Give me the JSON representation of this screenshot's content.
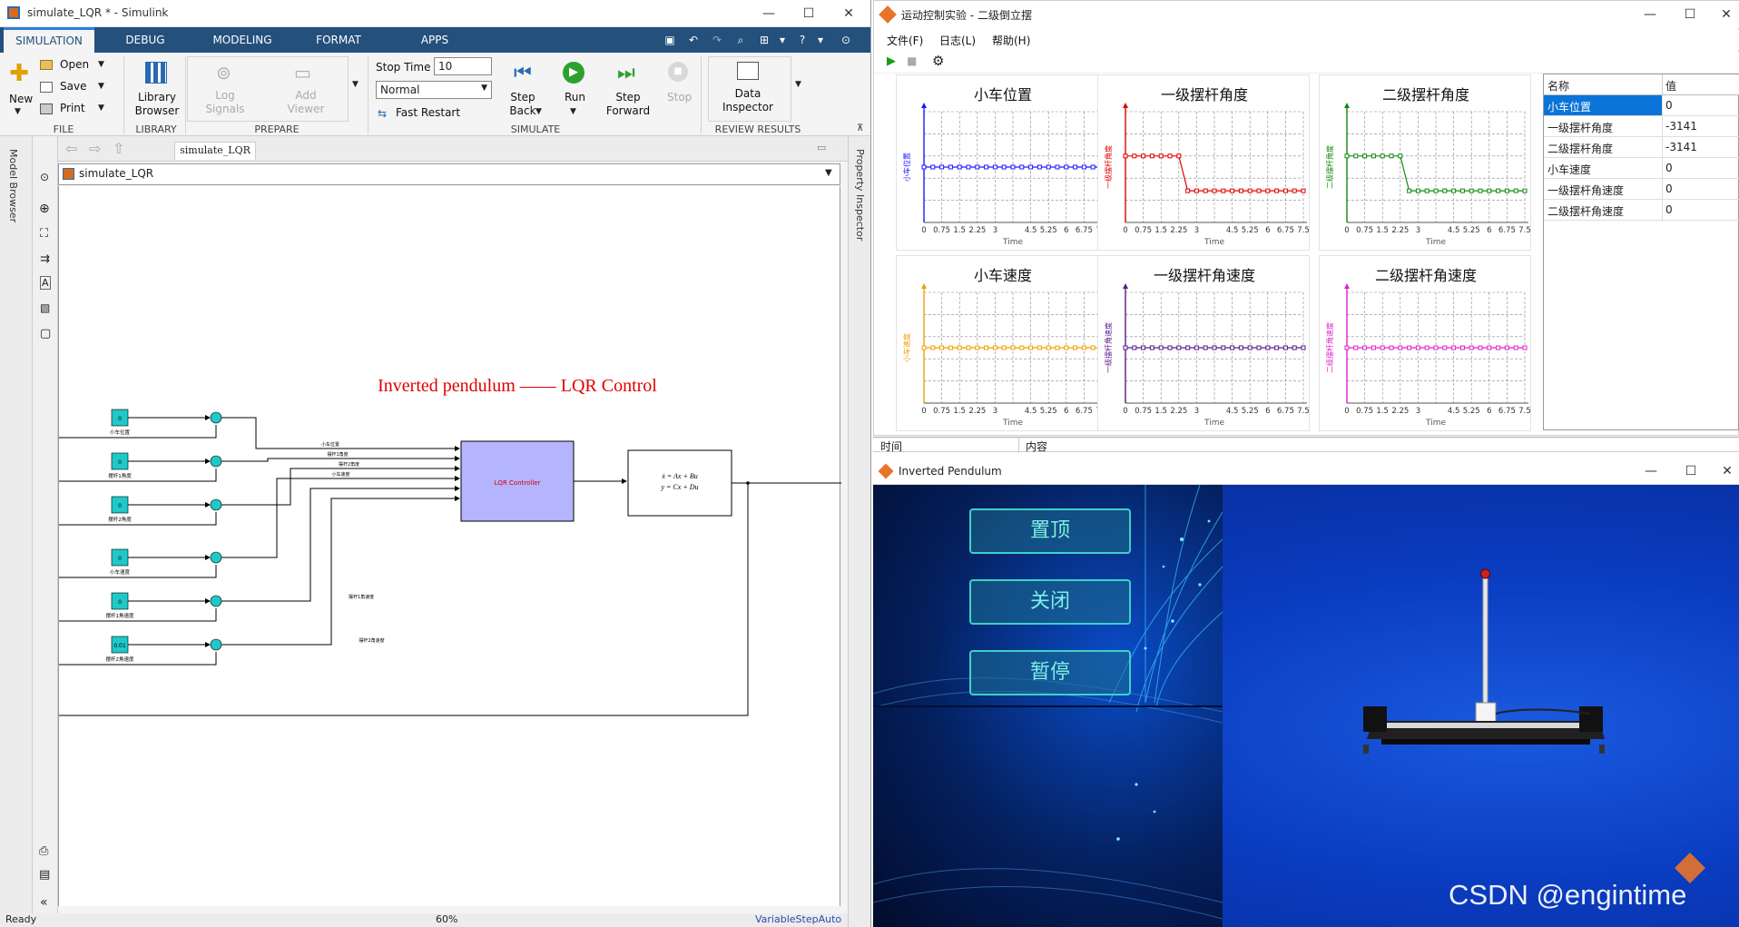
{
  "simulink": {
    "title": "simulate_LQR * - Simulink",
    "tabs": [
      "SIMULATION",
      "DEBUG",
      "MODELING",
      "FORMAT",
      "APPS"
    ],
    "ribbon": {
      "new": "New",
      "open": "Open",
      "save": "Save",
      "print": "Print",
      "library_browser": [
        "Library",
        "Browser"
      ],
      "log_signals": [
        "Log",
        "Signals"
      ],
      "add_viewer": [
        "Add",
        "Viewer"
      ],
      "stop_time_label": "Stop Time",
      "stop_time_value": "10",
      "mode": "Normal",
      "fast_restart": "Fast Restart",
      "step_back": [
        "Step",
        "Back"
      ],
      "run": "Run",
      "step_forward": [
        "Step",
        "Forward"
      ],
      "stop": "Stop",
      "data_inspector": [
        "Data",
        "Inspector"
      ],
      "groups": [
        "FILE",
        "LIBRARY",
        "PREPARE",
        "SIMULATE",
        "REVIEW RESULTS"
      ]
    },
    "breadcrumb_tab": "simulate_LQR",
    "model_path": "simulate_LQR",
    "model_browser": "Model Browser",
    "property_inspector": "Property Inspector",
    "diagram": {
      "title": "Inverted pendulum —— LQR Control",
      "constants": [
        {
          "value": "0",
          "label": "小车位置"
        },
        {
          "value": "0",
          "label": "摆杆1角度"
        },
        {
          "value": "0",
          "label": "摆杆2角度"
        },
        {
          "value": "0",
          "label": "小车速度"
        },
        {
          "value": "0",
          "label": "摆杆1角速度"
        },
        {
          "value": "0.01",
          "label": "摆杆2角速度"
        }
      ],
      "signal_labels": [
        "小车位置",
        "摆杆1角度",
        "摆杆2角度",
        "小车速度",
        "摆杆1角速度",
        "摆杆2角速度"
      ],
      "controller": "LQR Controller",
      "state_space": [
        "ẋ = Ax + Bu",
        "y = Cx + Du"
      ]
    },
    "status": {
      "left": "Ready",
      "zoom": "60%",
      "solver": "VariableStepAuto"
    }
  },
  "control": {
    "title": "运动控制实验 - 二级倒立摆",
    "menu": [
      "文件(F)",
      "日志(L)",
      "帮助(H)"
    ],
    "x_ticks": [
      "0",
      "0.75",
      "1.5",
      "2.25",
      "3",
      "4.5",
      "5.25",
      "6",
      "6.75",
      "7.5"
    ],
    "x_axis_label": "Time",
    "table_header": [
      "名称",
      "值"
    ],
    "table_rows": [
      {
        "name": "小车位置",
        "value": "0",
        "selected": true
      },
      {
        "name": "一级摆杆角度",
        "value": "-3141",
        "selected": false
      },
      {
        "name": "二级摆杆角度",
        "value": "-3141",
        "selected": false
      },
      {
        "name": "小车速度",
        "value": "0",
        "selected": false
      },
      {
        "name": "一级摆杆角速度",
        "value": "0",
        "selected": false
      },
      {
        "name": "二级摆杆角速度",
        "value": "0",
        "selected": false
      }
    ],
    "log_header": [
      "时间",
      "内容"
    ]
  },
  "chart_data": [
    {
      "type": "line",
      "title": "小车位置",
      "color": "#1a1aff",
      "ylabel": "小车位置",
      "xlabel": "Time",
      "x": [
        0,
        0.375,
        0.75,
        1.125,
        1.5,
        1.875,
        2.25,
        2.625,
        3,
        3.375,
        3.75,
        4.125,
        4.5,
        4.875,
        5.25,
        5.625,
        6,
        6.375,
        6.75,
        7.125,
        7.5
      ],
      "values": [
        0,
        0,
        0,
        0,
        0,
        0,
        0,
        0,
        0,
        0,
        0,
        0,
        0,
        0,
        0,
        0,
        0,
        0,
        0,
        0,
        0
      ],
      "ylim": [
        -2,
        2
      ],
      "grid": true
    },
    {
      "type": "line",
      "title": "一级摆杆角度",
      "color": "#e00000",
      "ylabel": "一级摆杆角度",
      "xlabel": "Time",
      "x": [
        0,
        0.375,
        0.75,
        1.125,
        1.5,
        1.875,
        2.25,
        2.625,
        3,
        3.375,
        3.75,
        4.125,
        4.5,
        4.875,
        5.25,
        5.625,
        6,
        6.375,
        6.75,
        7.125,
        7.5
      ],
      "values": [
        0,
        0,
        0,
        0,
        0,
        0,
        0,
        -3141,
        -3141,
        -3141,
        -3141,
        -3141,
        -3141,
        -3141,
        -3141,
        -3141,
        -3141,
        -3141,
        -3141,
        -3141,
        -3141
      ],
      "ylim": [
        -6000,
        4000
      ],
      "grid": true
    },
    {
      "type": "line",
      "title": "二级摆杆角度",
      "color": "#118811",
      "ylabel": "二级摆杆角度",
      "xlabel": "Time",
      "x": [
        0,
        0.375,
        0.75,
        1.125,
        1.5,
        1.875,
        2.25,
        2.625,
        3,
        3.375,
        3.75,
        4.125,
        4.5,
        4.875,
        5.25,
        5.625,
        6,
        6.375,
        6.75,
        7.125,
        7.5
      ],
      "values": [
        0,
        0,
        0,
        0,
        0,
        0,
        0,
        -3141,
        -3141,
        -3141,
        -3141,
        -3141,
        -3141,
        -3141,
        -3141,
        -3141,
        -3141,
        -3141,
        -3141,
        -3141,
        -3141
      ],
      "ylim": [
        -6000,
        4000
      ],
      "grid": true
    },
    {
      "type": "line",
      "title": "小车速度",
      "color": "#f0a000",
      "ylabel": "小车速度",
      "xlabel": "Time",
      "x": [
        0,
        0.375,
        0.75,
        1.125,
        1.5,
        1.875,
        2.25,
        2.625,
        3,
        3.375,
        3.75,
        4.125,
        4.5,
        4.875,
        5.25,
        5.625,
        6,
        6.375,
        6.75,
        7.125,
        7.5
      ],
      "values": [
        0,
        0,
        0,
        0,
        0,
        0,
        0,
        0,
        0,
        0,
        0,
        0,
        0,
        0,
        0,
        0,
        0,
        0,
        0,
        0,
        0
      ],
      "ylim": [
        -2,
        2
      ],
      "grid": true
    },
    {
      "type": "line",
      "title": "一级摆杆角速度",
      "color": "#5a1a8a",
      "ylabel": "一级摆杆角速度",
      "xlabel": "Time",
      "x": [
        0,
        0.375,
        0.75,
        1.125,
        1.5,
        1.875,
        2.25,
        2.625,
        3,
        3.375,
        3.75,
        4.125,
        4.5,
        4.875,
        5.25,
        5.625,
        6,
        6.375,
        6.75,
        7.125,
        7.5
      ],
      "values": [
        0,
        0,
        0,
        0,
        0,
        0,
        0,
        0,
        0,
        0,
        0,
        0,
        0,
        0,
        0,
        0,
        0,
        0,
        0,
        0,
        0
      ],
      "ylim": [
        -2,
        2
      ],
      "grid": true
    },
    {
      "type": "line",
      "title": "二级摆杆角速度",
      "color": "#e020d0",
      "ylabel": "二级摆杆角速度",
      "xlabel": "Time",
      "x": [
        0,
        0.375,
        0.75,
        1.125,
        1.5,
        1.875,
        2.25,
        2.625,
        3,
        3.375,
        3.75,
        4.125,
        4.5,
        4.875,
        5.25,
        5.625,
        6,
        6.375,
        6.75,
        7.125,
        7.5
      ],
      "values": [
        0,
        0,
        0,
        0,
        0,
        0,
        0,
        0,
        0,
        0,
        0,
        0,
        0,
        0,
        0,
        0,
        0,
        0,
        0,
        0,
        0
      ],
      "ylim": [
        -2,
        2
      ],
      "grid": true
    }
  ],
  "pendulum": {
    "title": "Inverted Pendulum",
    "buttons": [
      "置顶",
      "关闭",
      "暂停"
    ]
  },
  "watermark": "CSDN @engintime"
}
